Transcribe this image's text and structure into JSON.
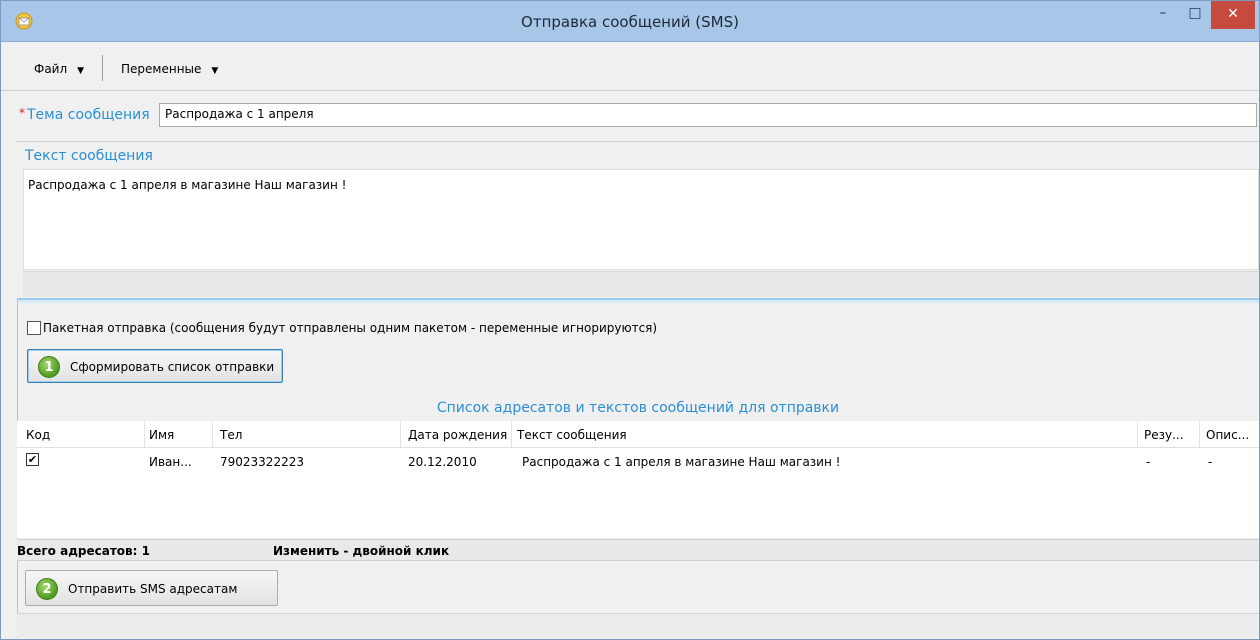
{
  "window": {
    "title": "Отправка сообщений (SMS)",
    "minimize": "–",
    "maximize": "□",
    "close": "✕"
  },
  "menu": {
    "file": "Файл",
    "variables": "Переменные",
    "arrow": "▼"
  },
  "subject": {
    "required_mark": "*",
    "label": "Тема сообщения",
    "value": "Распродажа с 1 апреля"
  },
  "message": {
    "label": "Текст сообщения",
    "value": "Распродажа с 1 апреля в магазине Наш магазин !"
  },
  "batch": {
    "checked": false,
    "label": "Пакетная отправка (сообщения будут отправлены одним пакетом - переменные игнорируются)"
  },
  "buttons": {
    "form_list": {
      "number": "1",
      "label": "Сформировать список отправки"
    },
    "send": {
      "number": "2",
      "label": "Отправить SMS адресатам"
    }
  },
  "recipients": {
    "title": "Список адресатов и текстов сообщений для отправки",
    "columns": [
      "Код",
      "Имя",
      "Тел",
      "Дата рождения",
      "Текст сообщения",
      "Резу...",
      "Опис..."
    ],
    "rows": [
      {
        "checked": true,
        "check_glyph": "✔",
        "name": "Иван...",
        "phone": "79023322223",
        "birth_date": "20.12.2010",
        "text": "Распродажа с 1 апреля в магазине Наш магазин !",
        "result": "-",
        "description": "-"
      }
    ]
  },
  "status": {
    "total": "Всего адресатов: 1",
    "hint": "Изменить - двойной клик"
  },
  "colors": {
    "titlebar": "#a7c6e8",
    "accent_label": "#2b8fd6",
    "close_button": "#c74a3f",
    "step_badge": "#4f9a22"
  }
}
